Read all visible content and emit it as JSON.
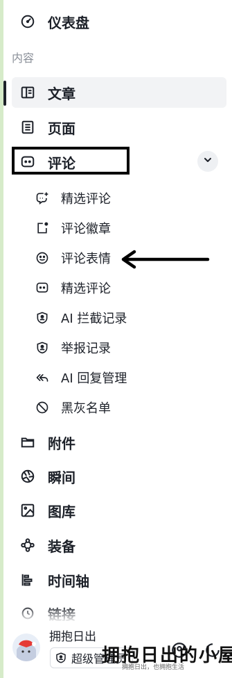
{
  "sidebar": {
    "dashboard": "仪表盘",
    "section_title": "内容",
    "posts": "文章",
    "pages": "页面",
    "comments": "评论",
    "comment_children": [
      "精选评论",
      "评论徽章",
      "评论表情",
      "精选评论",
      "AI 拦截记录",
      "举报记录",
      "AI 回复管理",
      "黑灰名单"
    ],
    "attachments": "附件",
    "moments": "瞬间",
    "gallery": "图库",
    "equipment": "装备",
    "timeline": "时间轴",
    "links": "链接"
  },
  "user": {
    "name": "拥抱日出",
    "role": "超级管理员"
  },
  "watermark": {
    "title": "拥抱日出的小屋",
    "subtitle": "拥抱日出，也拥抱生活"
  },
  "colors": {
    "accent": "#1d2129",
    "active_bg": "#f2f3f5",
    "left_strip": "#d6ebc9"
  }
}
